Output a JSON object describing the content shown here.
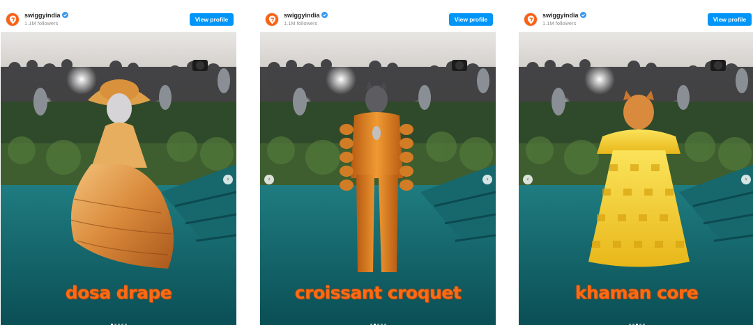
{
  "posts": [
    {
      "username": "swiggyindia",
      "followers": "1.1M followers",
      "view_profile": "View profile",
      "caption": "dosa drape",
      "slide_index": 0,
      "slide_count": 5,
      "has_prev": false,
      "has_next": true
    },
    {
      "username": "swiggyindia",
      "followers": "1.1M followers",
      "view_profile": "View profile",
      "caption": "croissant croquet",
      "slide_index": 1,
      "slide_count": 5,
      "has_prev": true,
      "has_next": true
    },
    {
      "username": "swiggyindia",
      "followers": "1.1M followers",
      "view_profile": "View profile",
      "caption": "khaman core",
      "slide_index": 2,
      "slide_count": 5,
      "has_prev": true,
      "has_next": true
    }
  ],
  "colors": {
    "brand": "#fc6011",
    "button": "#0095f6",
    "caption": "#ff6a13",
    "carpet": "#0f6a70"
  },
  "icons": {
    "avatar": "swiggy-logo-icon",
    "verified": "verified-badge-icon",
    "prev": "chevron-left-icon",
    "next": "chevron-right-icon"
  }
}
